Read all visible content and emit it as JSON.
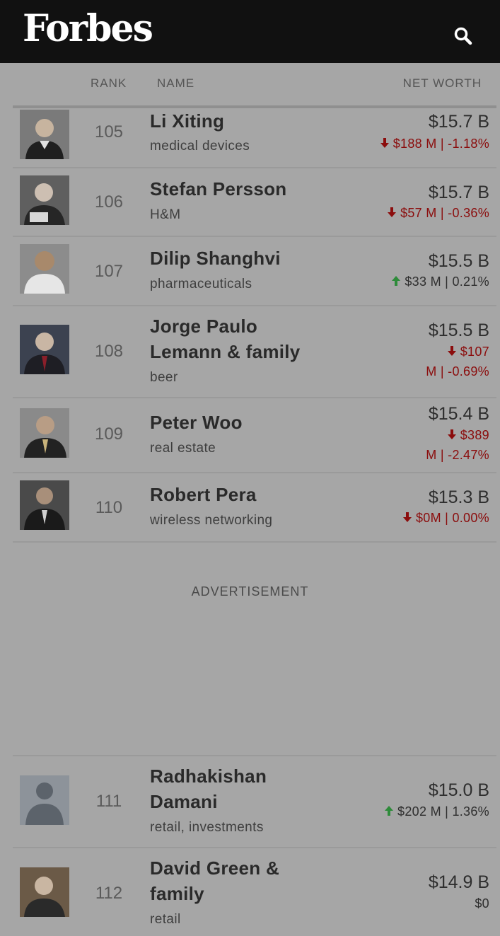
{
  "header": {
    "logo": "Forbes",
    "search_icon": "search-icon"
  },
  "columns": {
    "rank": "RANK",
    "name": "NAME",
    "net_worth": "NET WORTH"
  },
  "colors": {
    "down": "#8b0d0d",
    "up": "#2e8b3a",
    "header_bg": "#111111"
  },
  "rows": [
    {
      "rank": "105",
      "name": [
        "Li Xiting"
      ],
      "source": "medical devices",
      "worth": "$15.7 B",
      "change": [
        "$188 M | -1.18%"
      ],
      "dir": "down"
    },
    {
      "rank": "106",
      "name": [
        "Stefan Persson"
      ],
      "source": "H&M",
      "worth": "$15.7 B",
      "change": [
        "$57 M | -0.36%"
      ],
      "dir": "down"
    },
    {
      "rank": "107",
      "name": [
        "Dilip Shanghvi"
      ],
      "source": "pharmaceuticals",
      "worth": "$15.5 B",
      "change": [
        "$33 M | 0.21%"
      ],
      "dir": "up"
    },
    {
      "rank": "108",
      "name": [
        "Jorge Paulo",
        "Lemann & family"
      ],
      "source": "beer",
      "worth": "$15.5 B",
      "change": [
        "$107",
        "M | -0.69%"
      ],
      "dir": "down"
    },
    {
      "rank": "109",
      "name": [
        "Peter Woo"
      ],
      "source": "real estate",
      "worth": "$15.4 B",
      "change": [
        "$389",
        "M | -2.47%"
      ],
      "dir": "down"
    },
    {
      "rank": "110",
      "name": [
        "Robert Pera"
      ],
      "source": "wireless networking",
      "worth": "$15.3 B",
      "change": [
        "$0M | 0.00%"
      ],
      "dir": "down"
    },
    {
      "rank": "111",
      "name": [
        "Radhakishan",
        "Damani"
      ],
      "source": "retail, investments",
      "worth": "$15.0 B",
      "change": [
        "$202 M | 1.36%"
      ],
      "dir": "up"
    },
    {
      "rank": "112",
      "name": [
        "David Green &",
        "family"
      ],
      "source": "retail",
      "worth": "$14.9 B",
      "change": [
        "$0"
      ],
      "dir": "none"
    }
  ],
  "advertisement": "ADVERTISEMENT"
}
